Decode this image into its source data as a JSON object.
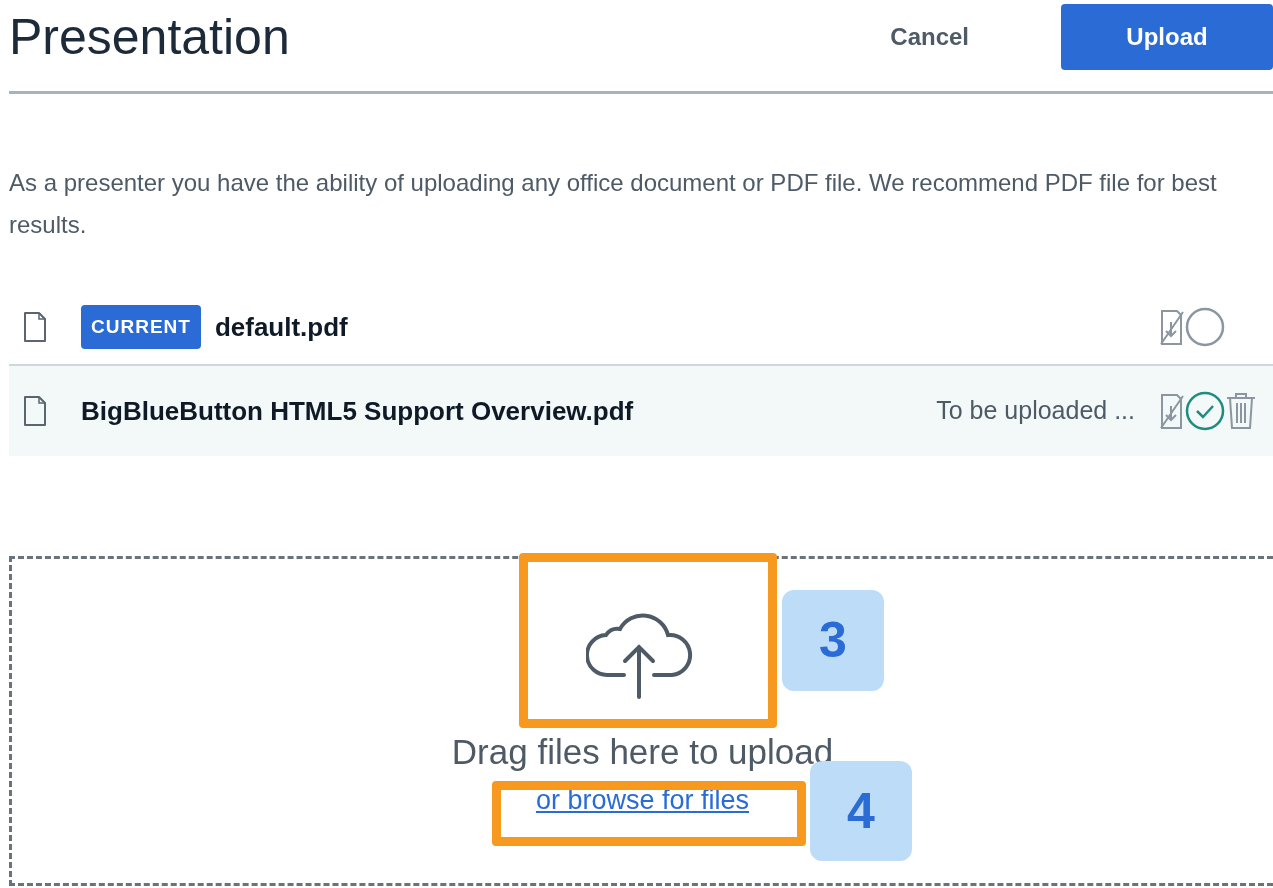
{
  "modal": {
    "title": "Presentation",
    "cancel_label": "Cancel",
    "confirm_label": "Upload"
  },
  "intro": "As a presenter you have the ability of uploading any office document or PDF file. We recommend PDF file for best results.",
  "files": [
    {
      "name": "default.pdf",
      "badge": "CURRENT",
      "current": true,
      "selected": false,
      "removable": false
    },
    {
      "name": "BigBlueButton HTML5 Support Overview.pdf",
      "current": false,
      "status": "To be uploaded ...",
      "selected": true,
      "removable": true
    }
  ],
  "dropzone": {
    "message": "Drag files here to upload",
    "browse_link": "or browse for files"
  },
  "callouts": [
    {
      "number": "3"
    },
    {
      "number": "4"
    }
  ]
}
